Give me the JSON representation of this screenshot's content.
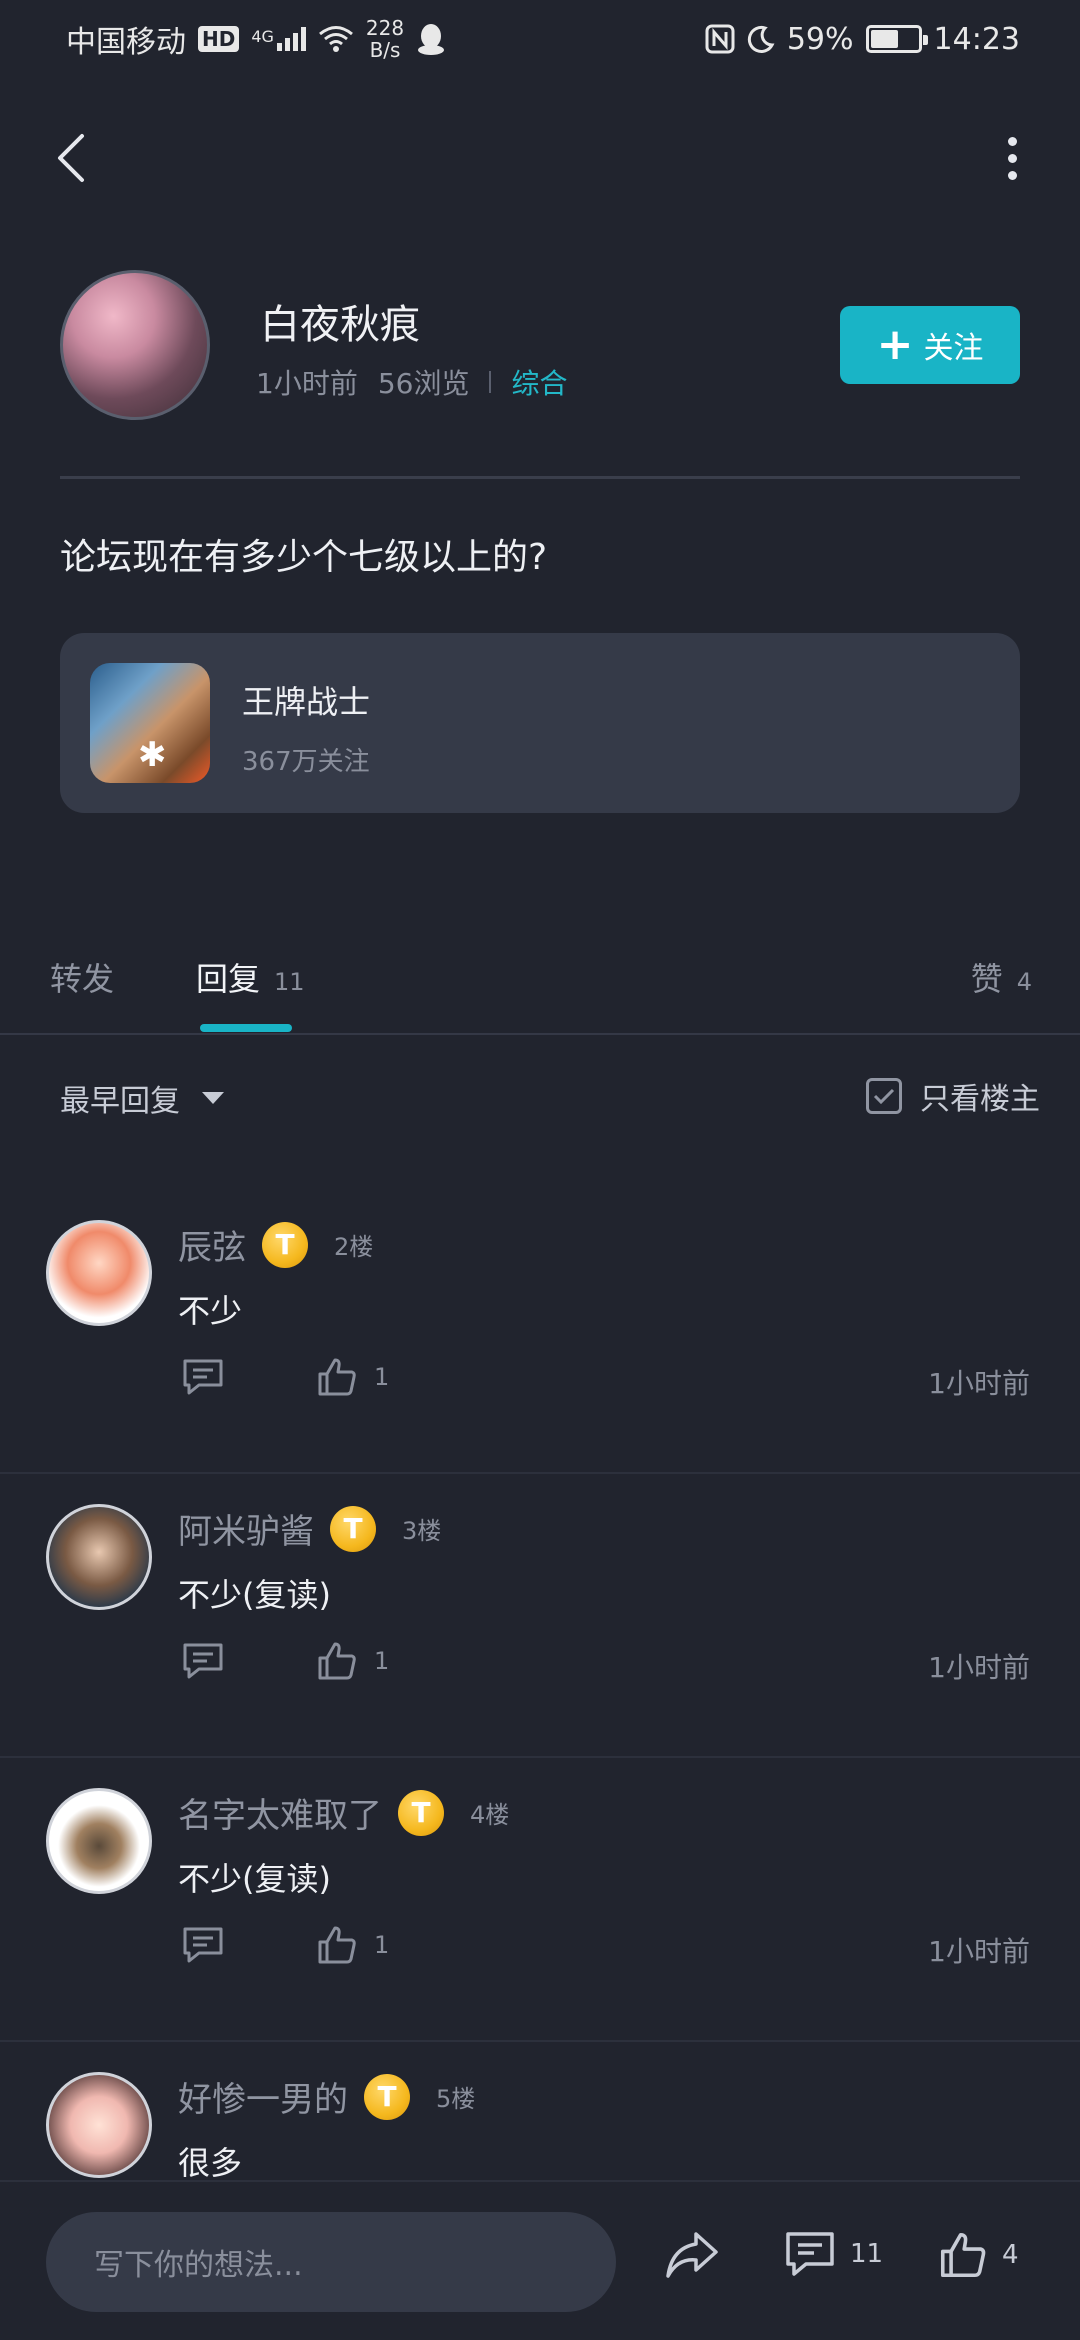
{
  "status_bar": {
    "carrier": "中国移动",
    "hd": "HD",
    "network": "4G",
    "speed_value": "228",
    "speed_unit": "B/s",
    "battery": "59%",
    "battery_level": 0.59,
    "time": "14:23"
  },
  "author": {
    "name": "白夜秋痕",
    "time_ago": "1小时前",
    "views": "56浏览",
    "category": "综合",
    "follow_label": "关注"
  },
  "post": {
    "title": "论坛现在有多少个七级以上的?"
  },
  "game_card": {
    "name": "王牌战士",
    "followers": "367万关注"
  },
  "tabs": [
    {
      "label": "转发",
      "count": ""
    },
    {
      "label": "回复",
      "count": "11"
    },
    {
      "label": "赞",
      "count": "4"
    }
  ],
  "sort": {
    "label": "最早回复",
    "owner_only": "只看楼主"
  },
  "replies": [
    {
      "name": "辰弦",
      "badge": "T",
      "floor": "2楼",
      "content": "不少",
      "likes": "1",
      "time": "1小时前"
    },
    {
      "name": "阿米驴酱",
      "badge": "T",
      "floor": "3楼",
      "content": "不少(复读)",
      "likes": "1",
      "time": "1小时前"
    },
    {
      "name": "名字太难取了",
      "badge": "T",
      "floor": "4楼",
      "content": "不少(复读)",
      "likes": "1",
      "time": "1小时前"
    },
    {
      "name": "好惨一男的",
      "badge": "T",
      "floor": "5楼",
      "content": "很多",
      "likes": "",
      "time": ""
    }
  ],
  "bottom_bar": {
    "input_placeholder": "写下你的想法...",
    "comment_count": "11",
    "like_count": "4"
  },
  "colors": {
    "background": "#21242e",
    "accent": "#19b4c6",
    "card": "#353a48",
    "coin": "#f5b81e"
  }
}
